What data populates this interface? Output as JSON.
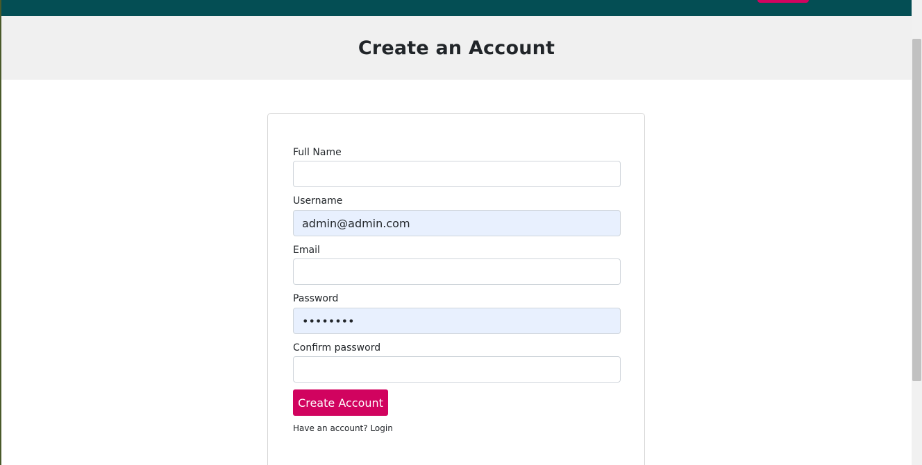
{
  "page": {
    "title": "Create an Account"
  },
  "form": {
    "fields": [
      {
        "label": "Full Name",
        "value": "",
        "type": "text"
      },
      {
        "label": "Username",
        "value": "admin@admin.com",
        "type": "text"
      },
      {
        "label": "Email",
        "value": "",
        "type": "email"
      },
      {
        "label": "Password",
        "value": "••••••••",
        "type": "password"
      },
      {
        "label": "Confirm password",
        "value": "",
        "type": "password"
      }
    ],
    "submit_label": "Create Account",
    "have_account_text": "Have an account?",
    "login_link_text": "Login"
  },
  "colors": {
    "topbar": "#044e54",
    "accent": "#d1035f",
    "header_band": "#f0f0f0",
    "autofill": "#e8f0fe"
  }
}
